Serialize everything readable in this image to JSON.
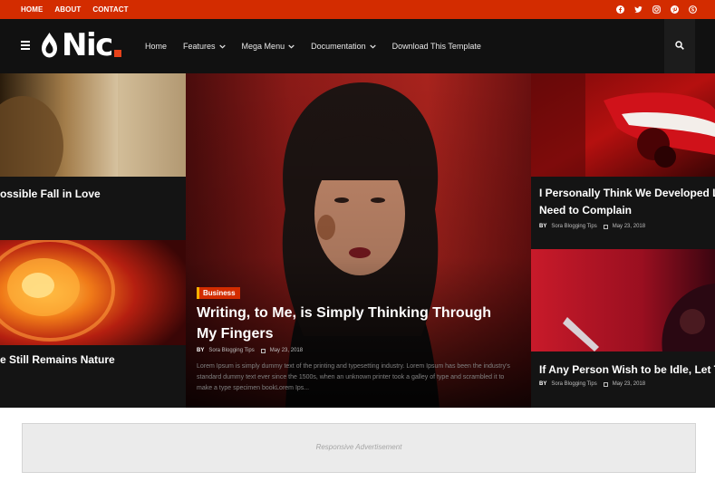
{
  "topbar": {
    "links": [
      "HOME",
      "ABOUT",
      "CONTACT"
    ],
    "social_icons": [
      "facebook-icon",
      "twitter-icon",
      "instagram-icon",
      "pinterest-icon",
      "skype-icon"
    ],
    "accent": "#d32c00"
  },
  "header": {
    "logo_text": "Nic",
    "nav": [
      {
        "label": "Home",
        "has_dropdown": false
      },
      {
        "label": "Features",
        "has_dropdown": true
      },
      {
        "label": "Mega Menu",
        "has_dropdown": true
      },
      {
        "label": "Documentation",
        "has_dropdown": true
      },
      {
        "label": "Download This Template",
        "has_dropdown": false
      }
    ]
  },
  "posts": {
    "left_top": {
      "title": "ossible Fall in Love"
    },
    "left_bottom": {
      "title": "e Still Remains Nature"
    },
    "featured": {
      "label": "Business",
      "title": "Writing, to Me, is Simply Thinking Through My Fingers",
      "by": "BY",
      "author": "Sora Blogging Tips",
      "date": "May 23, 2018",
      "excerpt": "Lorem Ipsum is simply dummy text of the printing and typesetting industry. Lorem Ipsum has been the industry's standard dummy text ever since the 1500s, when an unknown printer took a galley of type and scrambled it to make a type specimen bookLorem Ips..."
    },
    "right_top": {
      "title_line1": "I Personally Think We Developed Lar",
      "title_line2": "Need to Complain",
      "by": "BY",
      "author": "Sora Blogging Tips",
      "date": "May 23, 2018"
    },
    "right_bottom": {
      "title": "If Any Person Wish to be Idle, Let Th",
      "by": "BY",
      "author": "Sora Blogging Tips",
      "date": "May 23, 2018"
    }
  },
  "ad": {
    "text": "Responsive Advertisement"
  }
}
